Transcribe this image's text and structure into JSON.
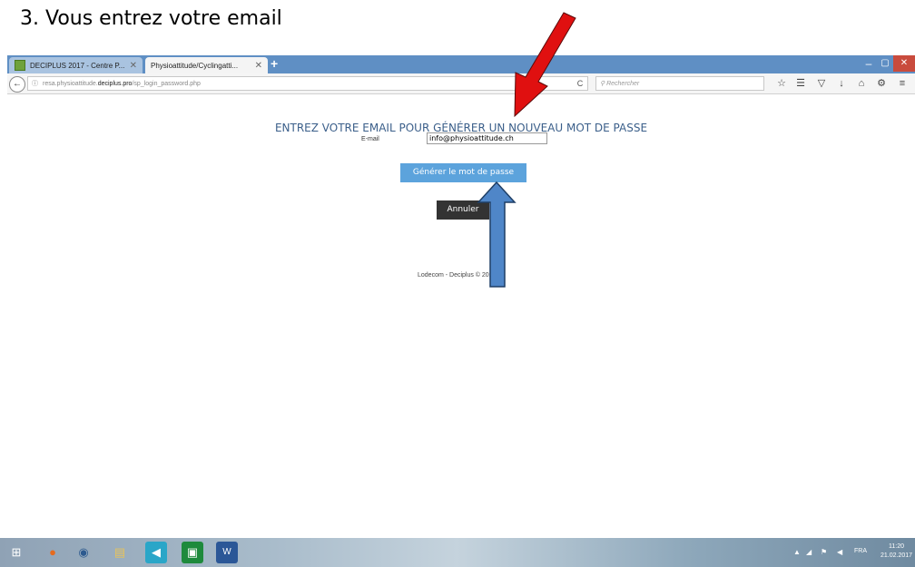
{
  "caption": "3. Vous entrez votre email",
  "browser": {
    "tabs": [
      {
        "label": "DECIPLUS 2017 - Centre P...",
        "close": "✕"
      },
      {
        "label": "Physioattitude/Cyclingatti...",
        "close": "✕"
      }
    ],
    "new_tab": "+",
    "window_controls": {
      "minimize": "–",
      "maximize": "▢",
      "close": "✕"
    },
    "back": "←",
    "url": {
      "info": "ⓘ",
      "prefix": "resa.physioattitude.",
      "domain": "deciplus.pro",
      "path": "/sp_login_password.php"
    },
    "reload": "C",
    "search_placeholder": "Rechercher",
    "toolbar_icons": [
      "☆",
      "☰",
      "▽",
      "↓",
      "⌂",
      "⚙",
      "≡"
    ]
  },
  "page": {
    "heading": "ENTREZ VOTRE EMAIL POUR GÉNÉRER UN NOUVEAU MOT DE PASSE",
    "email_label": "E-mail",
    "email_value": "info@physioattitude.ch",
    "generate_button": "Générer le mot de passe",
    "cancel_button": "Annuler",
    "footer": "Lodecom - Deciplus © 2013"
  },
  "annotations": {
    "red_arrow_color": "#e01010",
    "blue_arrow_color": "#4f86c8"
  },
  "taskbar": {
    "apps": [
      "⊞",
      "●",
      "◉",
      "▤",
      "◀",
      "▣",
      "W"
    ],
    "tray_lang": "FRA",
    "time": "11:20",
    "date": "21.02.2017"
  }
}
